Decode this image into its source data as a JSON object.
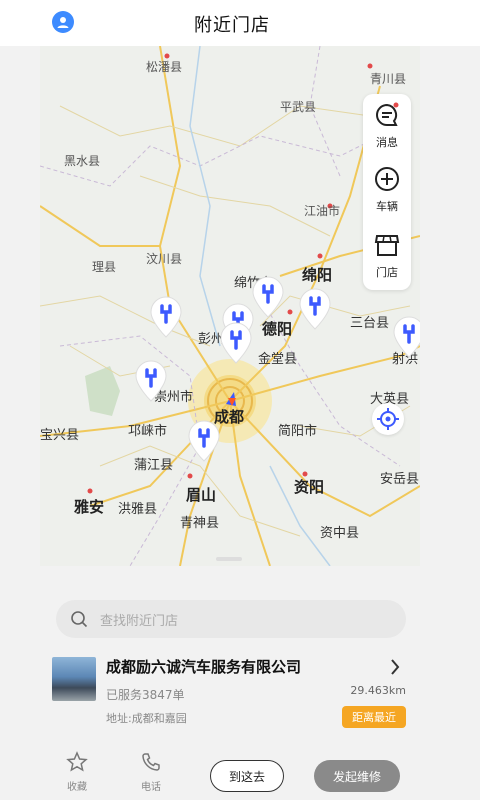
{
  "header": {
    "title": "附近门店"
  },
  "map": {
    "labels": {
      "songpan": "松潘县",
      "qingchuan": "青川县",
      "pingwu": "平武县",
      "heishui": "黑水县",
      "jiangyou": "江油市",
      "wenchuan": "汶川县",
      "li": "理县",
      "mianzhu": "绵竹市",
      "mianyang": "绵阳",
      "deyang": "德阳",
      "pengzhou": "彭州",
      "santai": "三台县",
      "jintang": "金堂县",
      "shehong": "射洪",
      "chongzhou": "崇州市",
      "chengdu": "成都",
      "baoxing": "宝兴县",
      "qionglai": "邛崃市",
      "jianyang": "简阳市",
      "dayin": "大英县",
      "pujiang": "蒲江县",
      "meishan": "眉山",
      "ziyang": "资阳",
      "anyue": "安岳县",
      "yaan": "雅安",
      "hongya": "洪雅县",
      "qingshen": "青神县",
      "zizhong": "资中县"
    },
    "side": {
      "messages": "消息",
      "vehicle": "车辆",
      "store": "门店"
    }
  },
  "search": {
    "placeholder": "查找附近门店"
  },
  "store": {
    "name": "成都励六诚汽车服务有限公司",
    "served": "已服务3847单",
    "address": "地址:成都和嘉园",
    "distance": "29.463km",
    "badge": "距离最近"
  },
  "bottom": {
    "favorite": "收藏",
    "phone": "电话",
    "go": "到这去",
    "rescue": "发起维修"
  },
  "colors": {
    "accent": "#3d5afe",
    "badge": "#f5a623",
    "rescue": "#8a8a8a"
  }
}
